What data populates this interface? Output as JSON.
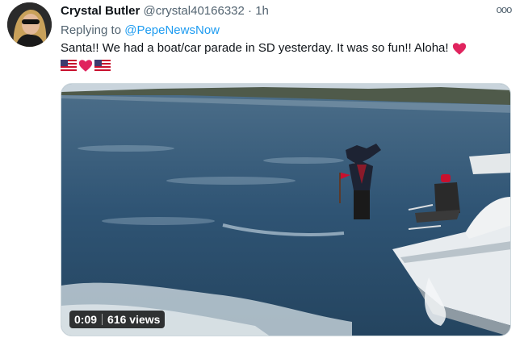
{
  "tweet": {
    "display_name": "Crystal Butler",
    "handle": "@crystal40166332",
    "separator": "·",
    "time": "1h",
    "more_label": "ooo",
    "replying_prefix": "Replying to",
    "replying_to": "@PepeNewsNow",
    "text": "Santa!! We had a boat/car parade in SD yesterday. It was so fun!! Aloha!",
    "emoji": [
      "us-flag",
      "red-heart",
      "us-flag"
    ]
  },
  "video": {
    "duration": "0:09",
    "views": "616 views"
  },
  "colors": {
    "text": "#0f1419",
    "secondary": "#536471",
    "link": "#1d9bf0",
    "heart": "#e0245e"
  }
}
